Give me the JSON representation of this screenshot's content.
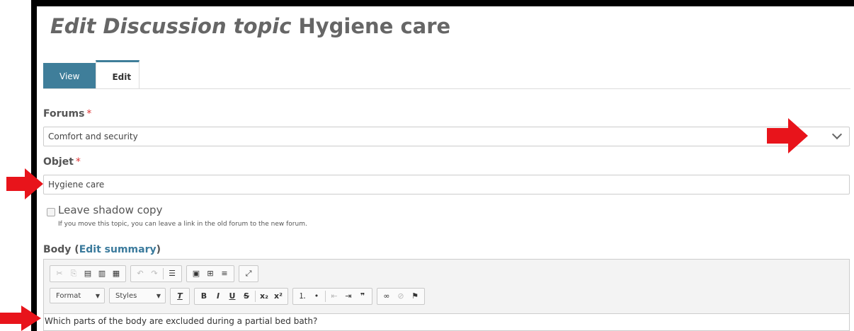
{
  "page": {
    "title_prefix": "Edit Discussion topic",
    "title_name": "Hygiene care"
  },
  "tabs": [
    {
      "label": "View"
    },
    {
      "label": "Edit"
    }
  ],
  "forums": {
    "label": "Forums",
    "required_mark": "*",
    "selected_value": "Comfort and security"
  },
  "objet": {
    "label": "Objet",
    "required_mark": "*",
    "value": "Hygiene care"
  },
  "shadow_copy": {
    "label": "Leave shadow copy",
    "help": "If you move this topic, you can leave a link in the old forum to the new forum."
  },
  "body": {
    "label_prefix": "Body (",
    "link_label": "Edit summary",
    "label_suffix": ")",
    "content": "Which parts of the body are excluded during a partial bed bath?"
  },
  "toolbar": {
    "format_label": "Format",
    "styles_label": "Styles"
  },
  "colors": {
    "accent": "#3f7e9a",
    "arrow": "#e8141b"
  }
}
